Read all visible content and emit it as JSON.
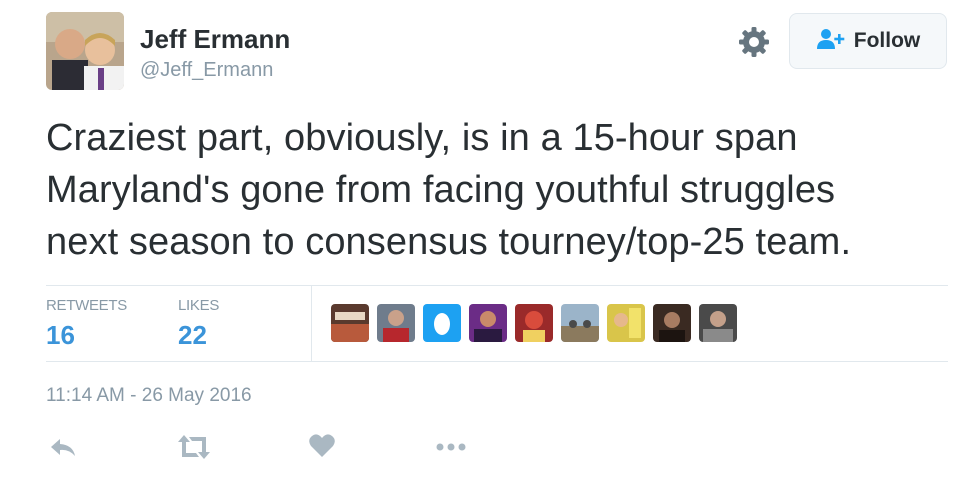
{
  "author": {
    "name": "Jeff Ermann",
    "handle": "@Jeff_Ermann"
  },
  "header": {
    "settings_icon": "gear-icon",
    "follow_label": "Follow",
    "follow_icon": "add-user-icon"
  },
  "tweet": {
    "lines": [
      "Craziest part, obviously, is in a 15-hour span",
      "Maryland's gone from facing youthful struggles",
      "next season to consensus tourney/top-25 team."
    ]
  },
  "stats": {
    "retweets_label": "RETWEETS",
    "retweets_count": "16",
    "likes_label": "LIKES",
    "likes_count": "22"
  },
  "likers_count_shown": 9,
  "timestamp": "11:14 AM - 26 May 2016",
  "actions": [
    "reply-icon",
    "retweet-icon",
    "like-icon",
    "more-icon"
  ],
  "colors": {
    "text": "#292f33",
    "muted": "#8899a6",
    "accent": "#3b94d9",
    "icon": "#aab8c2"
  }
}
